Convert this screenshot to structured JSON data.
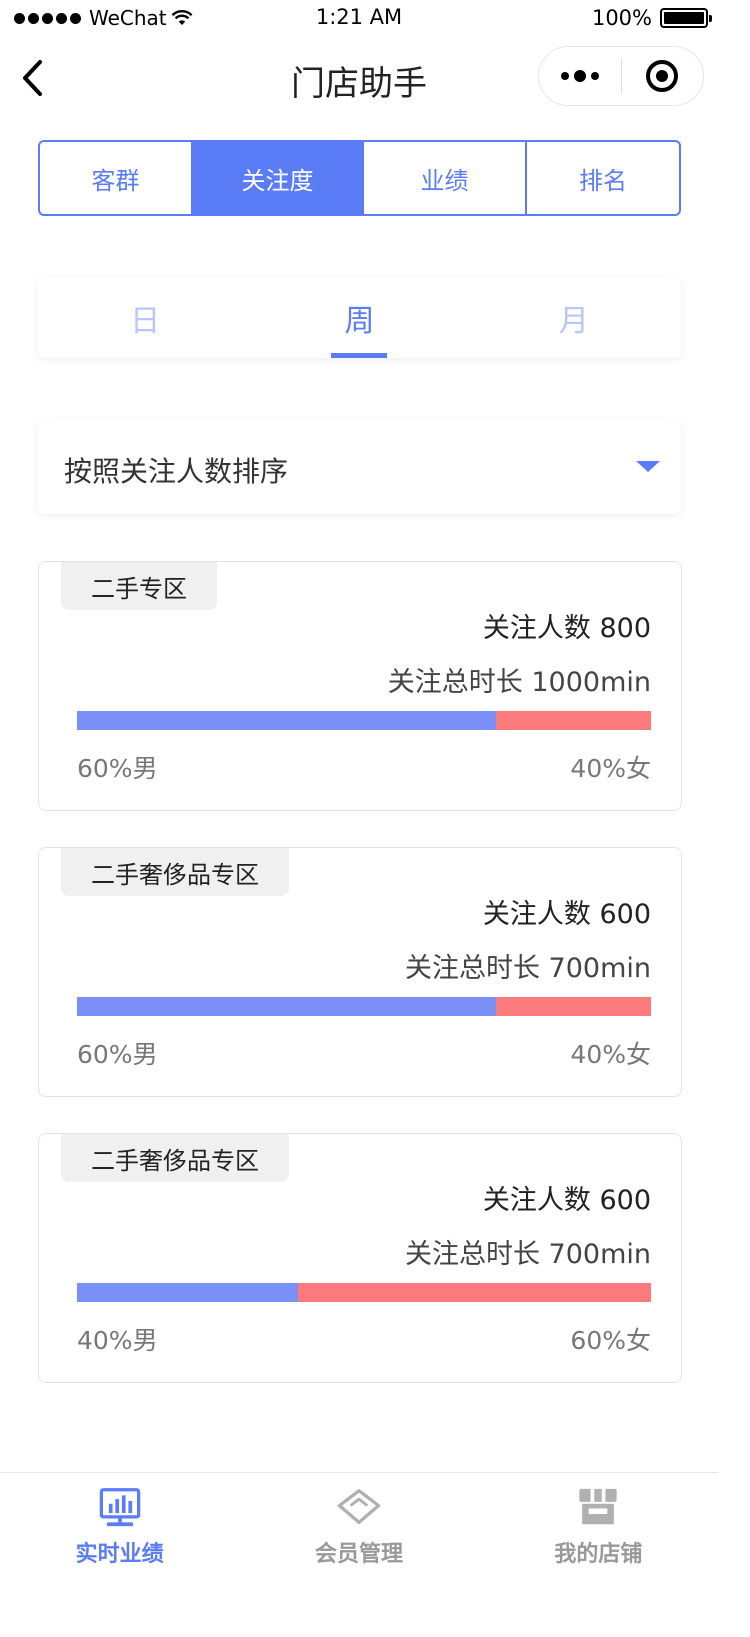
{
  "status_bar": {
    "carrier": "WeChat",
    "time": "1:21 AM",
    "battery": "100%"
  },
  "nav": {
    "title": "门店助手"
  },
  "top_tabs": [
    {
      "label": "客群",
      "active": false
    },
    {
      "label": "关注度",
      "active": true
    },
    {
      "label": "业绩",
      "active": false
    },
    {
      "label": "排名",
      "active": false
    }
  ],
  "period_tabs": [
    {
      "label": "日",
      "active": false
    },
    {
      "label": "周",
      "active": true
    },
    {
      "label": "月",
      "active": false
    }
  ],
  "sort": {
    "label": "按照关注人数排序"
  },
  "zones": [
    {
      "name": "二手专区",
      "followers": "关注人数 800",
      "duration": "关注总时长 1000min",
      "male_ratio": 0.73,
      "male_label": "60%男",
      "female_label": "40%女"
    },
    {
      "name": "二手奢侈品专区",
      "followers": "关注人数 600",
      "duration": "关注总时长 700min",
      "male_ratio": 0.73,
      "male_label": "60%男",
      "female_label": "40%女"
    },
    {
      "name": "二手奢侈品专区",
      "followers": "关注人数 600",
      "duration": "关注总时长 700min",
      "male_ratio": 0.385,
      "male_label": "40%男",
      "female_label": "60%女"
    }
  ],
  "bottom_tabs": [
    {
      "label": "实时业绩",
      "icon": "monitor-chart-icon",
      "active": true
    },
    {
      "label": "会员管理",
      "icon": "diamond-icon",
      "active": false
    },
    {
      "label": "我的店铺",
      "icon": "store-icon",
      "active": false
    }
  ],
  "colors": {
    "accent": "#5a7cf6",
    "male": "#7b90f6",
    "female": "#fb7b7c",
    "inactive_icon": "#b0b0b0"
  }
}
